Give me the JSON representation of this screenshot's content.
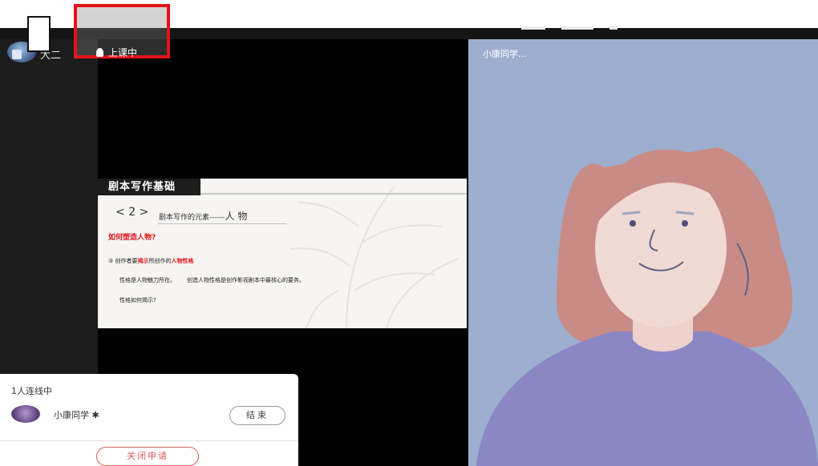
{
  "teacher": {
    "name": "大二"
  },
  "status": {
    "label": "上课中",
    "icon": "mic-icon"
  },
  "slide": {
    "title": "剧本写作基础",
    "section_number": "2",
    "section_title": "剧本写作的元素------",
    "section_title_emph": "人 物",
    "question": "如何塑造人物?",
    "point_prefix": "③ 创作者要",
    "point_red1": "揭示",
    "point_middle": "所创作的",
    "point_red2": "人物性格",
    "line1a": "性格是人物魅力所在。",
    "line1b": "创造人物性格是创作影视剧本中最核心的要务。",
    "line2": "性格如何揭示?"
  },
  "remote_video": {
    "name": "小康同学..."
  },
  "popup": {
    "title": "1人连线中",
    "user": "小康同学 ✱",
    "end_button": "结束",
    "close_apply_button": "关闭申请"
  },
  "colors": {
    "accent_red": "#e3121b",
    "video_bg": "#9eaece",
    "stage_bg": "#000000"
  }
}
